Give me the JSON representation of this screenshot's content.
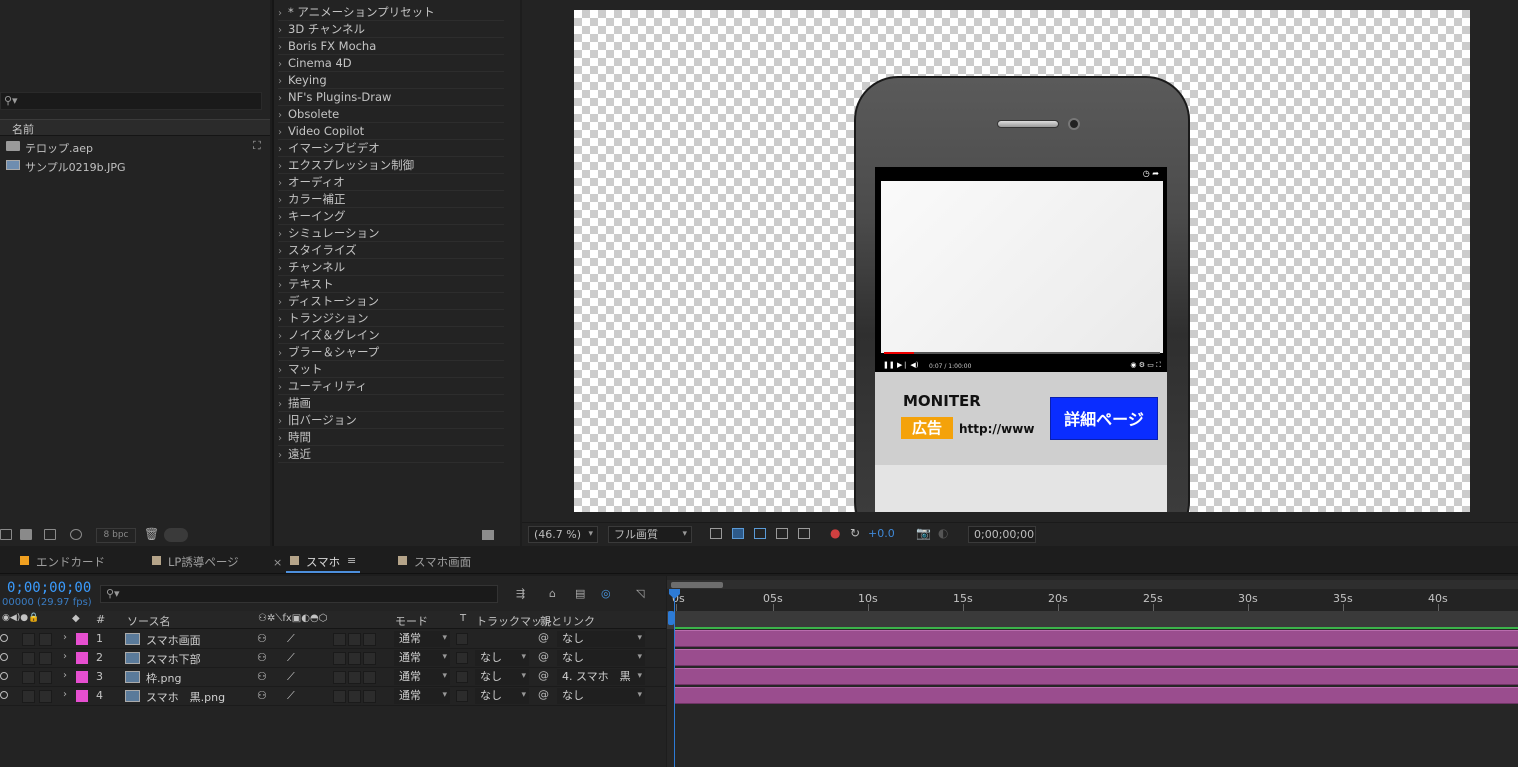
{
  "project": {
    "search_icon": "search-icon",
    "column_name": "名前",
    "items": [
      {
        "name": "テロップ.aep",
        "icon": "folder-icon"
      },
      {
        "name": "サンプル0219b.JPG",
        "icon": "image-file-icon"
      }
    ],
    "bpc": "8 bpc"
  },
  "effects": {
    "items": [
      "* アニメーションプリセット",
      "3D チャンネル",
      "Boris FX Mocha",
      "Cinema 4D",
      "Keying",
      "NF's Plugins-Draw",
      "Obsolete",
      "Video Copilot",
      "イマーシブビデオ",
      "エクスプレッション制御",
      "オーディオ",
      "カラー補正",
      "キーイング",
      "シミュレーション",
      "スタイライズ",
      "チャンネル",
      "テキスト",
      "ディストーション",
      "トランジション",
      "ノイズ＆グレイン",
      "ブラー＆シャープ",
      "マット",
      "ユーティリティ",
      "描画",
      "旧バージョン",
      "時間",
      "遠近"
    ]
  },
  "viewer": {
    "zoom": "(46.7 %)",
    "quality": "フル画質",
    "exposure": "+0.0",
    "timecode": "0;00;00;00",
    "ad": {
      "brand": "MONITER",
      "tag": "広告",
      "url": "http://www",
      "button": "詳細ページ"
    },
    "video_progress": 0.11,
    "video_time": "0:07 / 1:00:00"
  },
  "tabs": [
    {
      "label": "エンドカード",
      "color": "#f0a020",
      "active": false
    },
    {
      "label": "LP誘導ページ",
      "color": "#b5a489",
      "active": false
    },
    {
      "label": "スマホ",
      "color": "#b5a489",
      "active": true
    },
    {
      "label": "スマホ画面",
      "color": "#b5a489",
      "active": false
    }
  ],
  "timeline": {
    "timecode": "0;00;00;00",
    "fps": "00000 (29.97 fps)",
    "columns": {
      "hash": "#",
      "source": "ソース名",
      "mode": "モード",
      "t": "T",
      "track_matte": "トラックマット",
      "parent": "親とリンク"
    },
    "layers": [
      {
        "num": "1",
        "source": "スマホ画面",
        "mode": "通常",
        "track": "",
        "parent": "なし"
      },
      {
        "num": "2",
        "source": "スマホ下部",
        "mode": "通常",
        "track": "なし",
        "parent": "なし"
      },
      {
        "num": "3",
        "source": "枠.png",
        "mode": "通常",
        "track": "なし",
        "parent": "4. スマホ　黒"
      },
      {
        "num": "4",
        "source": "スマホ　黒.png",
        "mode": "通常",
        "track": "なし",
        "parent": "なし"
      }
    ],
    "ruler": [
      "0s",
      "05s",
      "10s",
      "15s",
      "20s",
      "25s",
      "30s",
      "35s",
      "40s"
    ],
    "layer_color": "#9a4d8e",
    "label_color": "#e64fd0"
  }
}
